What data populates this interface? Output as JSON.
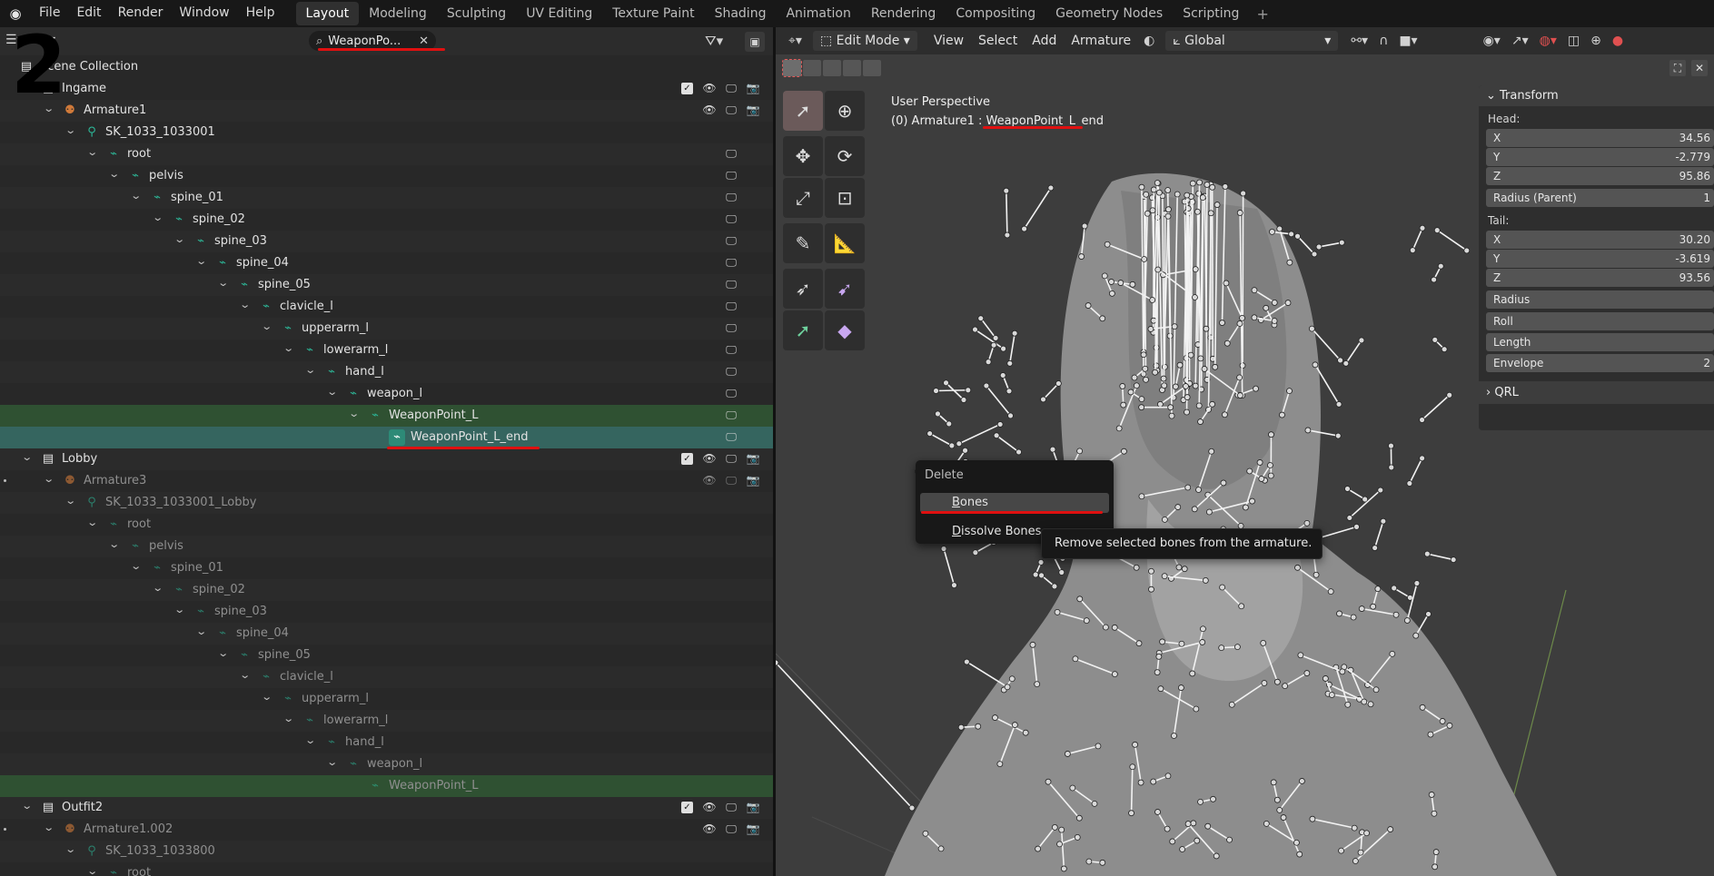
{
  "app": {
    "logo_icon": "blender-logo-icon"
  },
  "menu": [
    "File",
    "Edit",
    "Render",
    "Window",
    "Help"
  ],
  "workspaces": [
    "Layout",
    "Modeling",
    "Sculpting",
    "UV Editing",
    "Texture Paint",
    "Shading",
    "Animation",
    "Rendering",
    "Compositing",
    "Geometry Nodes",
    "Scripting"
  ],
  "workspace_add": "+",
  "annotation_number": "2",
  "outliner": {
    "search_value": "WeaponPo...",
    "scene_collection": "Scene Collection",
    "rows": [
      "Ingame",
      "Armature1",
      "SK_1033_1033001",
      "root",
      "pelvis",
      "spine_01",
      "spine_02",
      "spine_03",
      "spine_04",
      "spine_05",
      "clavicle_l",
      "upperarm_l",
      "lowerarm_l",
      "hand_l",
      "weapon_l",
      "WeaponPoint_L",
      "WeaponPoint_L_end",
      "Lobby",
      "Armature3",
      "SK_1033_1033001_Lobby",
      "root",
      "pelvis",
      "spine_01",
      "spine_02",
      "spine_03",
      "spine_04",
      "spine_05",
      "clavicle_l",
      "upperarm_l",
      "lowerarm_l",
      "hand_l",
      "weapon_l",
      "WeaponPoint_L",
      "Outfit2",
      "Armature1.002",
      "SK_1033_1033800",
      "root"
    ]
  },
  "viewport": {
    "mode": "Edit Mode",
    "menus": [
      "View",
      "Select",
      "Add",
      "Armature"
    ],
    "orientation": "Global",
    "perspective": "User Perspective",
    "object_prefix": "(0) Armature1 : ",
    "object_bone": "WeaponPoint_L_end"
  },
  "npanel": {
    "transform_title": "Transform",
    "head_label": "Head:",
    "head": [
      {
        "axis": "X",
        "value": "34.56"
      },
      {
        "axis": "Y",
        "value": "-2.779"
      },
      {
        "axis": "Z",
        "value": "95.86"
      }
    ],
    "radius_parent_label": "Radius (Parent)",
    "radius_parent_value": "1",
    "tail_label": "Tail:",
    "tail": [
      {
        "axis": "X",
        "value": "30.20"
      },
      {
        "axis": "Y",
        "value": "-3.619"
      },
      {
        "axis": "Z",
        "value": "93.56"
      }
    ],
    "radius_label": "Radius",
    "roll_label": "Roll",
    "length_label": "Length",
    "envelope_label": "Envelope",
    "envelope_value": "2",
    "qrl_title": "QRL"
  },
  "delete_menu": {
    "title": "Delete",
    "item1_u": "B",
    "item1_rest": "ones",
    "item2_u": "D",
    "item2_rest": "issolve Bones"
  },
  "tooltip": "Remove selected bones from the armature.",
  "colors": {
    "accent_red": "#e01010",
    "bone_teal": "#2cb596",
    "selected_row": "#2f5132",
    "active_row": "#35655f"
  }
}
